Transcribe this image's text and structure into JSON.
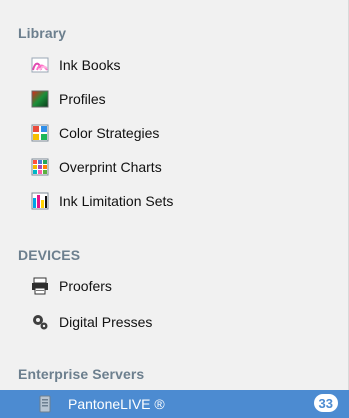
{
  "library": {
    "title": "Library",
    "items": [
      {
        "label": "Ink Books",
        "icon": "ink-book-icon"
      },
      {
        "label": "Profiles",
        "icon": "profile-icon"
      },
      {
        "label": "Color Strategies",
        "icon": "color-strategy-icon"
      },
      {
        "label": "Overprint Charts",
        "icon": "overprint-chart-icon"
      },
      {
        "label": "Ink Limitation Sets",
        "icon": "ink-limitation-icon"
      }
    ]
  },
  "devices": {
    "title": "DEVICES",
    "items": [
      {
        "label": "Proofers",
        "icon": "printer-icon"
      },
      {
        "label": "Digital Presses",
        "icon": "gears-icon"
      }
    ]
  },
  "enterprise": {
    "title": "Enterprise Servers",
    "items": [
      {
        "label": "PantoneLIVE ®",
        "icon": "server-icon",
        "badge": "33"
      }
    ]
  },
  "colors": {
    "section_header": "#6c7f8e",
    "selection": "#4c8bd1",
    "background": "#f1f1f1"
  }
}
